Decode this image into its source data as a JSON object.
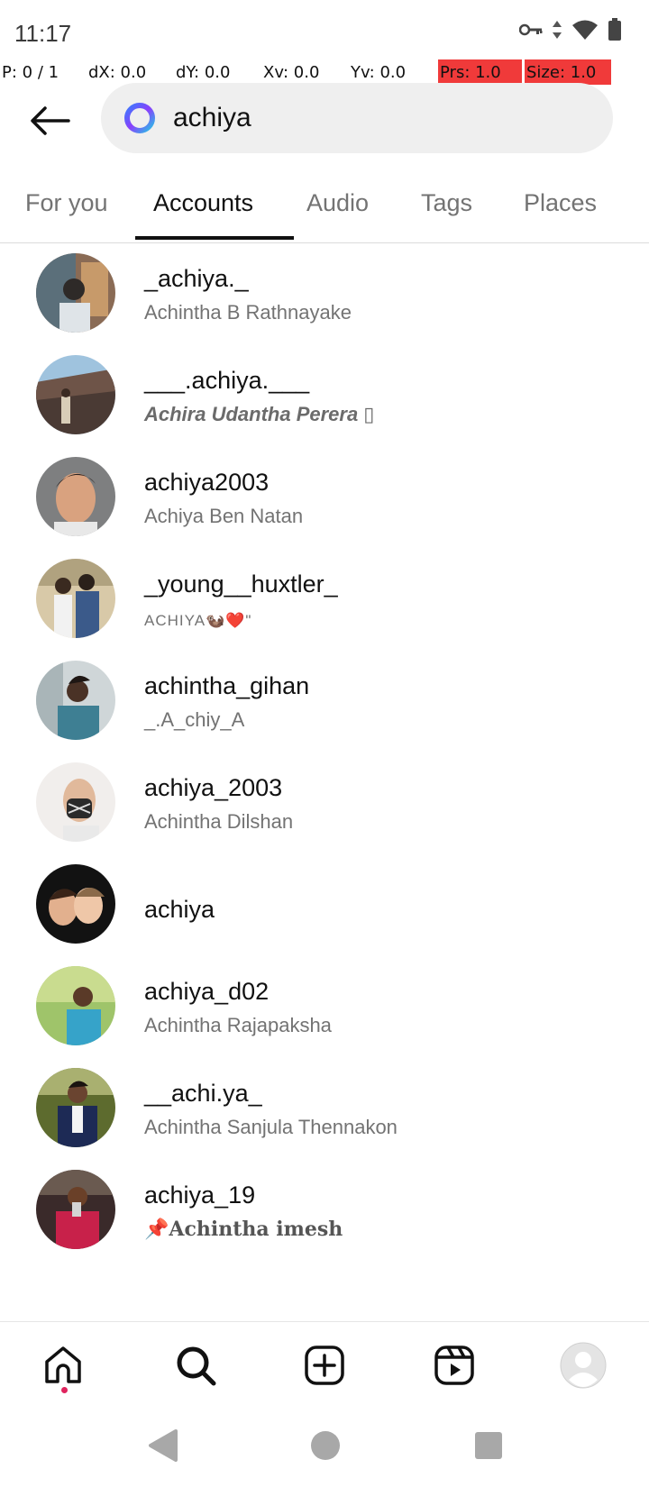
{
  "status_bar": {
    "time": "11:17"
  },
  "debug": {
    "p": "P: 0 / 1",
    "dx": "dX: 0.0",
    "dy": "dY: 0.0",
    "xv": "Xv: 0.0",
    "yv": "Yv: 0.0",
    "prs": "Prs: 1.0",
    "size": "Size: 1.0"
  },
  "search": {
    "query": "achiya"
  },
  "tabs": [
    {
      "label": "For you",
      "active": false
    },
    {
      "label": "Accounts",
      "active": true
    },
    {
      "label": "Audio",
      "active": false
    },
    {
      "label": "Tags",
      "active": false
    },
    {
      "label": "Places",
      "active": false
    }
  ],
  "results": [
    {
      "username": "_achiya._",
      "full_name": "Achintha B Rathnayake"
    },
    {
      "username": "___.achiya.___",
      "full_name": "Achira Udantha Perera ▯"
    },
    {
      "username": "achiya2003",
      "full_name": "Achiya Ben Natan"
    },
    {
      "username": "_young__huxtler_",
      "full_name": "ACHIYA🦦❤️\""
    },
    {
      "username": "achintha_gihan",
      "full_name": "_.A_chiy_A"
    },
    {
      "username": "achiya_2003",
      "full_name": "Achintha Dilshan"
    },
    {
      "username": "achiya",
      "full_name": ""
    },
    {
      "username": "achiya_d02",
      "full_name": "Achintha Rajapaksha"
    },
    {
      "username": "__achi.ya_",
      "full_name": "Achintha Sanjula Thennakon"
    },
    {
      "username": "achiya_19",
      "full_name": "📌𝐀𝐜𝐡𝐢𝐧𝐭𝐡𝐚 𝐢𝐦𝐞𝐬𝐡"
    }
  ],
  "bottom_nav": [
    "home-icon",
    "search-icon",
    "create-icon",
    "reels-icon",
    "profile-icon"
  ],
  "colors": {
    "accent": "#111111",
    "secondary_text": "#737373",
    "notification_dot": "#e0245e",
    "debug_red": "#f03a3a"
  }
}
